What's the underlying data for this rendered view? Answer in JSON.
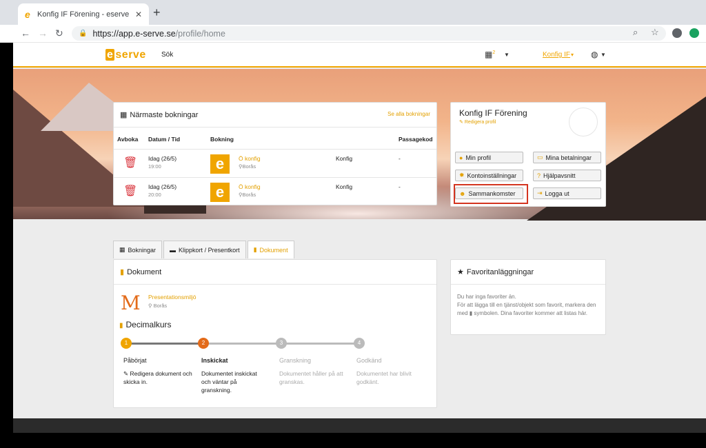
{
  "browser": {
    "tab_title": "Konfig IF Förening - eserve",
    "url_host": "https://app.e-serve.se",
    "url_path": "/profile/home"
  },
  "navbar": {
    "logo": "serve",
    "logo_letter": "e",
    "search": "Sök",
    "notif_count": "2",
    "user": "Konfig IF"
  },
  "bookings": {
    "title": "Närmaste bokningar",
    "see_all": "Se alla bokningar",
    "columns": [
      "Avboka",
      "Datum / Tid",
      "Bokning",
      "Passagekod"
    ],
    "rows": [
      {
        "date": "Idag (26/5)",
        "time": "19:00",
        "name": "Ö konfig",
        "location": "Borås",
        "type": "Konfig",
        "code": "-"
      },
      {
        "date": "Idag (26/5)",
        "time": "20:00",
        "name": "Ö konfig",
        "location": "Borås",
        "type": "Konfig",
        "code": "-"
      }
    ]
  },
  "profile": {
    "name": "Konfig IF Förening",
    "edit": "Redigera profil",
    "buttons": {
      "min_profil": "Min profil",
      "mina_betalningar": "Mina betalningar",
      "kontoinstallningar": "Kontoinställningar",
      "hjalpavsnitt": "Hjälpavsnitt",
      "sammankomster": "Sammankomster",
      "logga_ut": "Logga ut"
    }
  },
  "tabs": {
    "bokningar": "Bokningar",
    "klippkort": "Klippkort / Presentkort",
    "dokument": "Dokument"
  },
  "document": {
    "title": "Dokument",
    "item_letter": "M",
    "item_name": "Presentationsmiljö",
    "item_location": "Borås",
    "course": "Decimalkurs",
    "steps": [
      {
        "num": "1",
        "label": "Påbörjat",
        "desc": "Redigera dokument och skicka in."
      },
      {
        "num": "2",
        "label": "Inskickat",
        "desc": "Dokumentet inskickat och väntar på granskning."
      },
      {
        "num": "3",
        "label": "Granskning",
        "desc": "Dokumentet håller på att granskas."
      },
      {
        "num": "4",
        "label": "Godkänd",
        "desc": "Dokumentet har blivit godkänt."
      }
    ]
  },
  "favorites": {
    "title": "Favoritanläggningar",
    "line1": "Du har inga favoriter än.",
    "line2a": "För att lägga till en tjänst/objekt som favorit, markera den med ",
    "line2b": " symbolen. Dina favoriter kommer att listas här."
  },
  "colors": {
    "brand": "#f0a500",
    "step_active": "#e36b1a",
    "highlight": "#d4341f"
  }
}
